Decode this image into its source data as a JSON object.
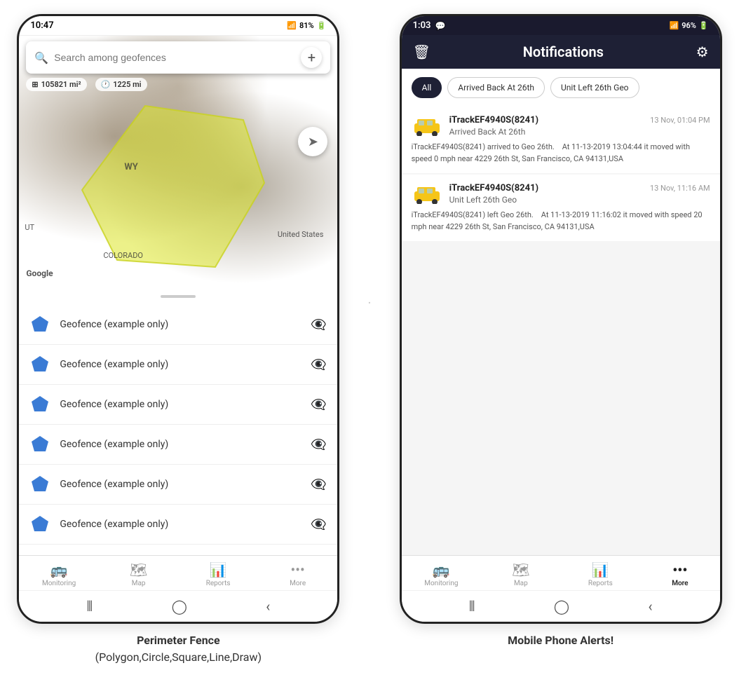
{
  "left_phone": {
    "status_bar": {
      "time": "10:47",
      "signal": "WiFi",
      "battery": "81%"
    },
    "search": {
      "placeholder": "Search among geofences"
    },
    "map": {
      "stat1_icon": "area",
      "stat1_value": "105821 mi²",
      "stat2_icon": "distance",
      "stat2_value": "1225 mi",
      "label_wy": "WY",
      "label_us": "United States",
      "label_ut": "UT",
      "label_co": "COLORADO",
      "google_label": "Google"
    },
    "geofences": [
      {
        "name": "Geofence (example only)"
      },
      {
        "name": "Geofence (example only)"
      },
      {
        "name": "Geofence (example only)"
      },
      {
        "name": "Geofence (example only)"
      },
      {
        "name": "Geofence (example only)"
      },
      {
        "name": "Geofence (example only)"
      }
    ],
    "bottom_nav": [
      {
        "label": "Monitoring",
        "icon": "🚌"
      },
      {
        "label": "Map",
        "icon": "🗺"
      },
      {
        "label": "Reports",
        "icon": "📊"
      },
      {
        "label": "More",
        "icon": "···"
      }
    ],
    "caption": "Perimeter Fence\n(Polygon,Circle,Square,Line,Draw)"
  },
  "right_phone": {
    "status_bar": {
      "time": "1:03",
      "signal": "96%",
      "chat_icon": true
    },
    "header": {
      "title": "Notifications",
      "delete_icon": "trash",
      "settings_icon": "gear"
    },
    "filter_tabs": [
      {
        "label": "All",
        "active": true
      },
      {
        "label": "Arrived Back At 26th",
        "active": false
      },
      {
        "label": "Unit Left 26th Geo",
        "active": false
      }
    ],
    "notifications": [
      {
        "device_name": "iTrackEF4940S(8241)",
        "timestamp": "13 Nov, 01:04 PM",
        "event": "Arrived Back At 26th",
        "body": "iTrackEF4940S(8241) arrived to Geo 26th.   At 11-13-2019 13:04:44 it moved with speed 0 mph near 4229 26th St, San Francisco, CA 94131,USA",
        "car_color": "#f5c518"
      },
      {
        "device_name": "iTrackEF4940S(8241)",
        "timestamp": "13 Nov, 11:16 AM",
        "event": "Unit Left 26th Geo",
        "body": "iTrackEF4940S(8241) left Geo 26th.   At 11-13-2019 11:16:02 it moved with speed 20 mph near 4229 26th St, San Francisco, CA 94131,USA",
        "car_color": "#f5c518"
      }
    ],
    "bottom_nav": [
      {
        "label": "Monitoring",
        "icon": "🚌"
      },
      {
        "label": "Map",
        "icon": "🗺"
      },
      {
        "label": "Reports",
        "icon": "📊"
      },
      {
        "label": "More",
        "icon": "···"
      }
    ],
    "caption": "Mobile Phone Alerts!"
  },
  "colors": {
    "accent": "#1e2035",
    "geofence_yellow": "rgba(220,230,40,0.55)",
    "pentagon_blue": "#3a7bd5"
  }
}
